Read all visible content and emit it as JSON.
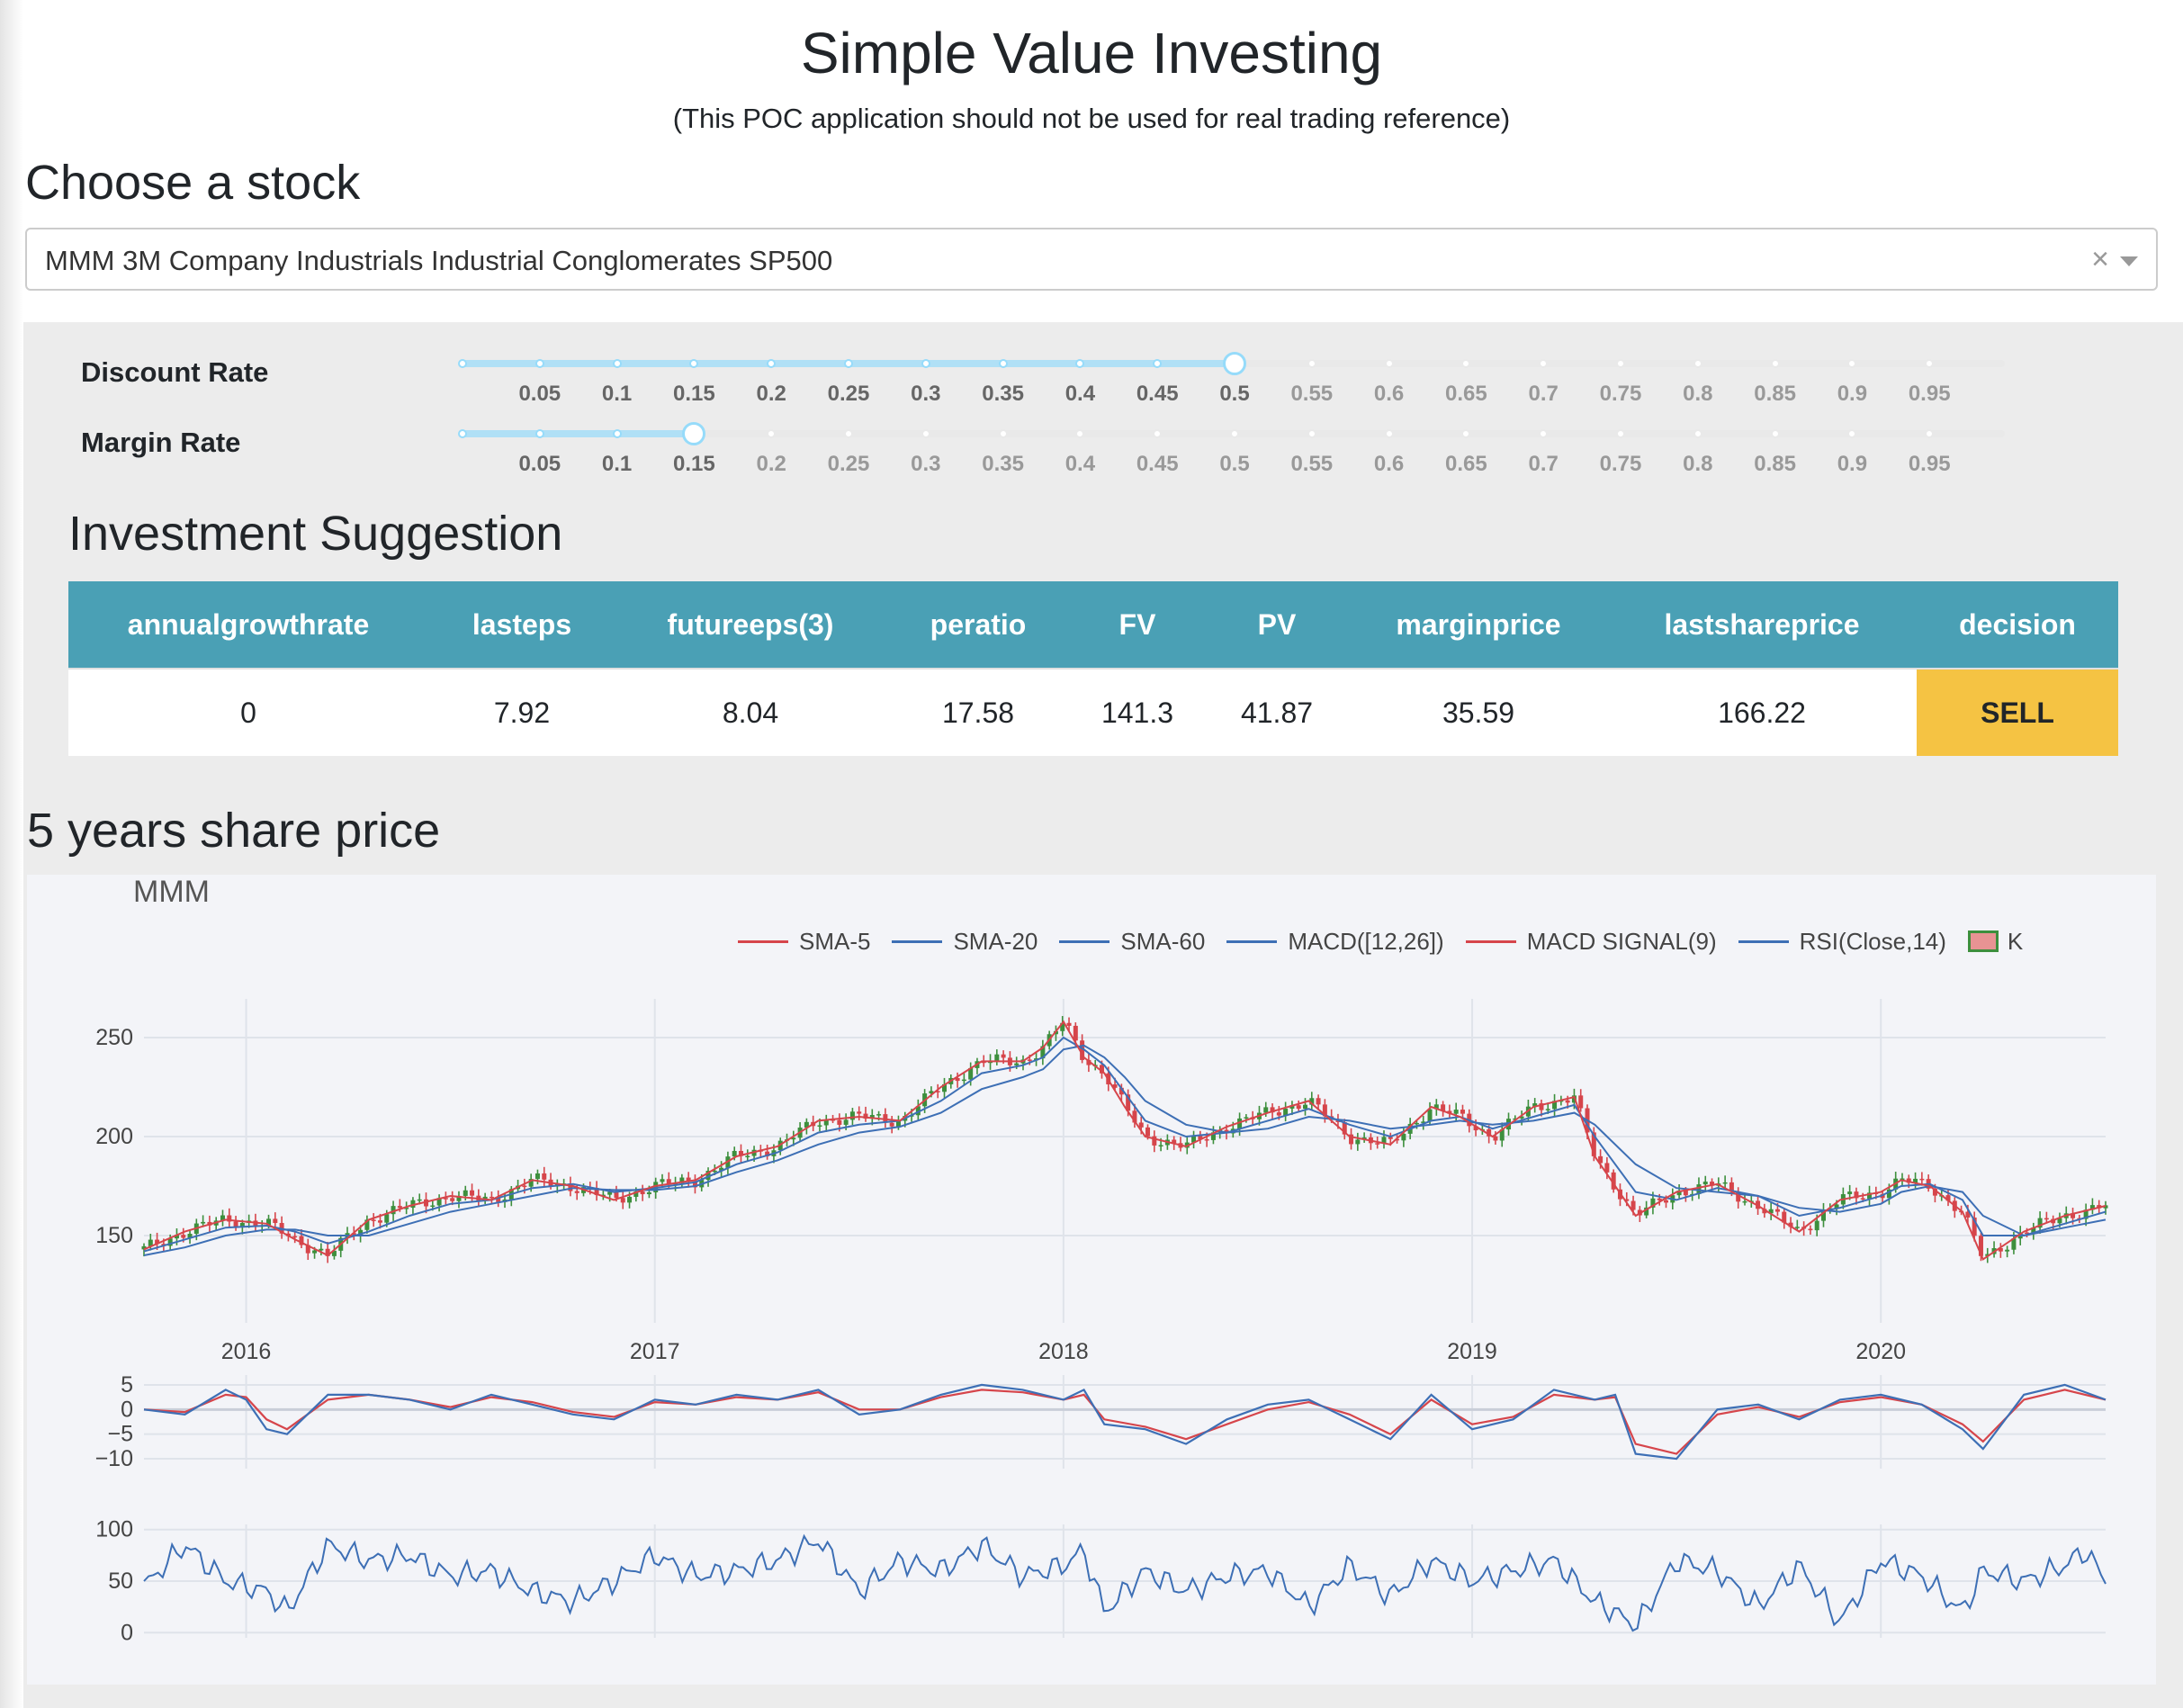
{
  "header": {
    "title": "Simple Value Investing",
    "subtitle": "(This POC application should not be used for real trading reference)"
  },
  "stock_picker": {
    "heading": "Choose a stock",
    "selected": "MMM 3M Company Industrials Industrial Conglomerates SP500",
    "clear_glyph": "×"
  },
  "sliders": {
    "discount": {
      "label": "Discount Rate",
      "value": 0.5
    },
    "margin": {
      "label": "Margin Rate",
      "value": 0.15
    },
    "ticks": [
      "0.05",
      "0.1",
      "0.15",
      "0.2",
      "0.25",
      "0.3",
      "0.35",
      "0.4",
      "0.45",
      "0.5",
      "0.55",
      "0.6",
      "0.65",
      "0.7",
      "0.75",
      "0.8",
      "0.85",
      "0.9",
      "0.95"
    ]
  },
  "suggestion": {
    "heading": "Investment Suggestion",
    "columns": [
      "annualgrowthrate",
      "lasteps",
      "futureeps(3)",
      "peratio",
      "FV",
      "PV",
      "marginprice",
      "lastshareprice",
      "decision"
    ],
    "row": [
      "0",
      "7.92",
      "8.04",
      "17.58",
      "141.3",
      "41.87",
      "35.59",
      "166.22",
      "SELL"
    ]
  },
  "chart_section": {
    "heading": "5 years share price"
  },
  "colors": {
    "table_header": "#4aa0b5",
    "decision_bg": "#f5c343",
    "series_red": "#d6454b",
    "series_blue": "#3d6fb5",
    "candle_up": "#3d8f3d",
    "candle_down": "#d6454b"
  },
  "chart_data": {
    "type": "line",
    "title": "MMM",
    "legend": [
      "SMA-5",
      "SMA-20",
      "SMA-60",
      "MACD([12,26])",
      "MACD SIGNAL(9)",
      "RSI(Close,14)",
      "K"
    ],
    "legend_colors": [
      "#d6454b",
      "#3d6fb5",
      "#3d6fb5",
      "#3d6fb5",
      "#d6454b",
      "#3d6fb5",
      "candle"
    ],
    "legend_placement": "top-right",
    "price": {
      "x_ticks": [
        "2016",
        "2017",
        "2018",
        "2019",
        "2020"
      ],
      "y_ticks": [
        150,
        200,
        250
      ],
      "ylim": [
        115,
        265
      ],
      "xlim": [
        2015.75,
        2020.55
      ],
      "x": [
        2015.75,
        2015.85,
        2015.95,
        2016.05,
        2016.12,
        2016.2,
        2016.3,
        2016.4,
        2016.5,
        2016.6,
        2016.7,
        2016.8,
        2016.9,
        2017.0,
        2017.1,
        2017.2,
        2017.3,
        2017.4,
        2017.5,
        2017.6,
        2017.7,
        2017.8,
        2017.9,
        2017.95,
        2018.0,
        2018.05,
        2018.1,
        2018.15,
        2018.2,
        2018.3,
        2018.4,
        2018.5,
        2018.6,
        2018.7,
        2018.8,
        2018.9,
        2018.97,
        2019.05,
        2019.15,
        2019.25,
        2019.3,
        2019.4,
        2019.5,
        2019.6,
        2019.7,
        2019.8,
        2019.9,
        2020.0,
        2020.05,
        2020.12,
        2020.2,
        2020.25,
        2020.35,
        2020.45,
        2020.55
      ],
      "close": [
        143,
        152,
        158,
        156,
        148,
        140,
        158,
        165,
        170,
        168,
        178,
        175,
        168,
        175,
        178,
        190,
        195,
        208,
        210,
        208,
        225,
        238,
        238,
        245,
        258,
        240,
        232,
        215,
        200,
        195,
        205,
        212,
        218,
        200,
        196,
        215,
        210,
        200,
        215,
        220,
        190,
        160,
        172,
        176,
        165,
        152,
        168,
        172,
        178,
        175,
        162,
        138,
        152,
        160,
        165
      ],
      "sma20": [
        142,
        148,
        154,
        155,
        152,
        146,
        152,
        160,
        166,
        168,
        174,
        176,
        172,
        174,
        177,
        186,
        192,
        202,
        206,
        208,
        218,
        232,
        236,
        240,
        250,
        244,
        236,
        222,
        208,
        200,
        202,
        208,
        214,
        206,
        200,
        208,
        210,
        204,
        210,
        216,
        200,
        172,
        168,
        174,
        170,
        160,
        164,
        170,
        175,
        176,
        168,
        150,
        150,
        156,
        162
      ],
      "sma60": [
        140,
        144,
        150,
        153,
        153,
        150,
        150,
        156,
        162,
        166,
        170,
        174,
        173,
        173,
        175,
        182,
        188,
        196,
        202,
        205,
        212,
        224,
        230,
        234,
        244,
        246,
        240,
        230,
        218,
        206,
        202,
        204,
        210,
        208,
        204,
        206,
        208,
        206,
        208,
        212,
        206,
        186,
        174,
        172,
        170,
        164,
        162,
        166,
        172,
        175,
        172,
        160,
        150,
        154,
        158
      ]
    },
    "macd": {
      "y_ticks": [
        5,
        0,
        -5,
        -10
      ],
      "ylim": [
        -12,
        7
      ],
      "x": [
        2015.75,
        2015.85,
        2015.95,
        2016.0,
        2016.05,
        2016.1,
        2016.2,
        2016.3,
        2016.4,
        2016.5,
        2016.6,
        2016.7,
        2016.8,
        2016.9,
        2017.0,
        2017.1,
        2017.2,
        2017.3,
        2017.4,
        2017.5,
        2017.6,
        2017.7,
        2017.8,
        2017.9,
        2018.0,
        2018.05,
        2018.1,
        2018.2,
        2018.3,
        2018.4,
        2018.5,
        2018.6,
        2018.7,
        2018.8,
        2018.9,
        2019.0,
        2019.1,
        2019.2,
        2019.3,
        2019.35,
        2019.4,
        2019.5,
        2019.6,
        2019.7,
        2019.8,
        2019.9,
        2020.0,
        2020.1,
        2020.2,
        2020.25,
        2020.35,
        2020.45,
        2020.55
      ],
      "macd": [
        0,
        -1,
        4,
        2,
        -4,
        -5,
        3,
        3,
        2,
        0,
        3,
        1,
        -1,
        -2,
        2,
        1,
        3,
        2,
        4,
        -1,
        0,
        3,
        5,
        4,
        2,
        4,
        -3,
        -4,
        -7,
        -2,
        1,
        2,
        -2,
        -6,
        3,
        -4,
        -2,
        4,
        2,
        3,
        -9,
        -10,
        0,
        1,
        -2,
        2,
        3,
        1,
        -4,
        -8,
        3,
        5,
        2
      ],
      "signal": [
        0,
        -0.5,
        3,
        2.5,
        -2,
        -4,
        2,
        3,
        2,
        0.5,
        2.5,
        1.5,
        -0.5,
        -1.5,
        1.5,
        1,
        2.5,
        2,
        3.5,
        0,
        0,
        2.5,
        4,
        3.5,
        2,
        3,
        -2,
        -3.5,
        -6,
        -3,
        0,
        1.5,
        -1,
        -5,
        2,
        -3,
        -1.5,
        3,
        2,
        2.5,
        -7,
        -9,
        -1,
        0.5,
        -1.5,
        1.5,
        2.5,
        1,
        -3,
        -6.5,
        2,
        4,
        2
      ]
    },
    "rsi": {
      "y_ticks": [
        100,
        50,
        0
      ],
      "ylim": [
        -5,
        105
      ],
      "x": [
        2015.75,
        2015.85,
        2015.95,
        2016.05,
        2016.1,
        2016.2,
        2016.3,
        2016.4,
        2016.5,
        2016.6,
        2016.7,
        2016.8,
        2016.9,
        2017.0,
        2017.1,
        2017.2,
        2017.3,
        2017.4,
        2017.5,
        2017.6,
        2017.7,
        2017.8,
        2017.9,
        2018.0,
        2018.05,
        2018.1,
        2018.2,
        2018.3,
        2018.4,
        2018.5,
        2018.6,
        2018.7,
        2018.8,
        2018.9,
        2019.0,
        2019.1,
        2019.2,
        2019.3,
        2019.35,
        2019.4,
        2019.5,
        2019.6,
        2019.7,
        2019.8,
        2019.9,
        2020.0,
        2020.1,
        2020.2,
        2020.25,
        2020.35,
        2020.45,
        2020.5,
        2020.55
      ],
      "values": [
        45,
        85,
        50,
        40,
        20,
        85,
        70,
        75,
        55,
        60,
        40,
        30,
        50,
        75,
        55,
        60,
        70,
        90,
        40,
        70,
        60,
        85,
        55,
        65,
        80,
        20,
        60,
        40,
        55,
        60,
        25,
        65,
        35,
        70,
        50,
        60,
        70,
        30,
        20,
        5,
        70,
        60,
        25,
        65,
        10,
        70,
        55,
        20,
        60,
        50,
        65,
        80,
        50
      ]
    }
  }
}
